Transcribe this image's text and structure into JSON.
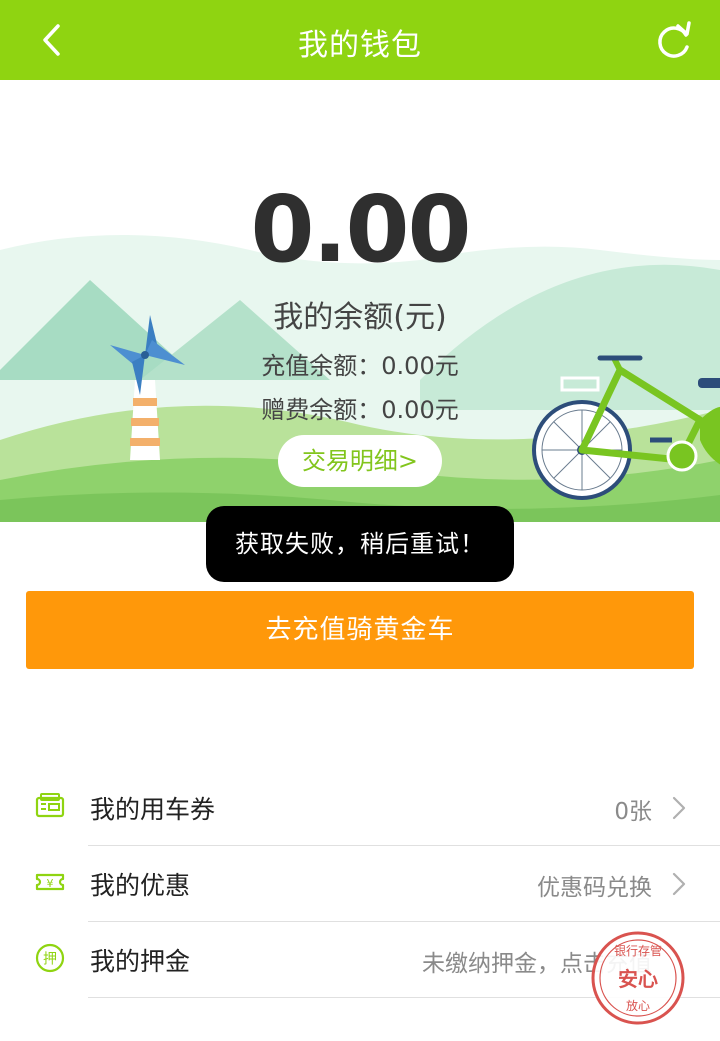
{
  "header": {
    "title": "我的钱包"
  },
  "wallet": {
    "balance": "0.00",
    "balance_label": "我的余额(元)",
    "recharge_balance": "充值余额：0.00元",
    "bonus_balance": "赠费余额：0.00元",
    "detail_button": "交易明细>"
  },
  "toast": "获取失败，稍后重试！",
  "charge_button": "去充值骑黄金车",
  "menu": [
    {
      "label": "我的用车券",
      "value": "0张",
      "icon": "ticket-icon"
    },
    {
      "label": "我的优惠",
      "value": "优惠码兑换",
      "icon": "coupon-icon"
    },
    {
      "label": "我的押金",
      "value": "未缴纳押金，点击充值",
      "icon": "deposit-icon"
    }
  ],
  "seal": {
    "top_text": "银行存管",
    "center_text": "安心",
    "bottom_text": "放心"
  },
  "colors": {
    "header": "#8fd411",
    "charge_button": "#ff980a",
    "accent_green": "#82c51d"
  }
}
